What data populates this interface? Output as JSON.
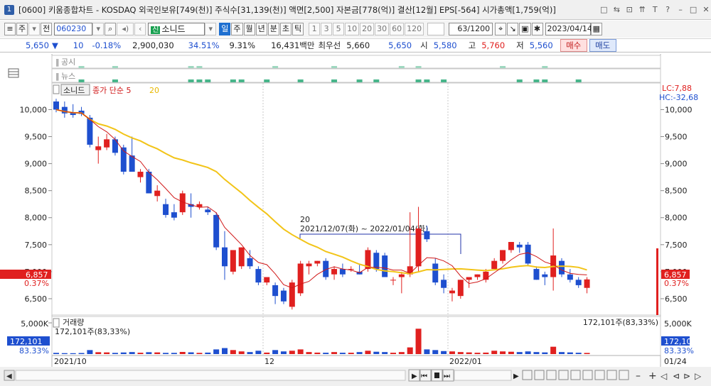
{
  "titlebar": {
    "window_number": "1",
    "title": "[0600] 키움종합차트 - KOSDAQ 외국인보유[749(천)] 주식수[31,139(천)] 액면[2,500] 자본금[778(억)] 결산[12월] EPS[-564] 시가총액[1,759(억)]",
    "buttons": [
      "□",
      "⇆",
      "⊡",
      "⇈",
      "T",
      "?",
      "–",
      "□",
      "✕"
    ]
  },
  "toolbar": {
    "period_label": "주",
    "all_label": "전",
    "code": "060230",
    "sin_label": "신",
    "stock_name": "소니드",
    "intervals": [
      "일",
      "주",
      "월",
      "년",
      "분",
      "초",
      "틱"
    ],
    "minute_values": [
      "1",
      "3",
      "5",
      "10",
      "20",
      "30",
      "60",
      "120"
    ],
    "count": "63",
    "count_total": "/1200",
    "date": "2023/04/14"
  },
  "price": {
    "current": "5,650",
    "arrow": "▼",
    "change": "10",
    "change_pct": "-0.18%",
    "volume": "2,900,030",
    "turnover": "34.51%",
    "vol_ratio": "9.31%",
    "amount": "16,431백만",
    "pref_label": "최우선",
    "best_ask": "5,660",
    "best_bid": "5,650",
    "open_label": "시",
    "open": "5,580",
    "high_label": "고",
    "high": "5,760",
    "low_label": "저",
    "low": "5,560",
    "buy_label": "매수",
    "sell_label": "매도"
  },
  "panels": {
    "disclosure_label": "공시",
    "news_label": "뉴스",
    "price_legend_name": "소니드",
    "price_legend_ma": "종가 단순 5",
    "price_legend_ma20": "20",
    "volume_label": "거래량",
    "volume_value": "172,101주(83,33%)",
    "volume_value_right": "172,101주(83,33%)",
    "range_title": "20",
    "range_text": "2021/12/07(화) ~ 2022/01/04(화)",
    "lc": "LC:7,88",
    "hc": "HC:-32,68",
    "last_price_tag": "6,857",
    "last_pct_tag": "0.37%",
    "vol_tag": "172,101",
    "vol_pct_tag": "83.33%",
    "vol_axis_top": "5,000K",
    "end_date": "01/24"
  },
  "colors": {
    "up": "#e0201f",
    "down": "#1e4fcf",
    "ma5": "#d01818",
    "ma20": "#f2c418"
  },
  "chart_data": {
    "type": "candlestick",
    "y_axis_ticks": [
      10000,
      9500,
      9000,
      8500,
      8000,
      7500,
      7000,
      6500
    ],
    "y_axis_labels": [
      "10,000",
      "9,500",
      "9,000",
      "8,500",
      "8,000",
      "7,500",
      "7,000",
      "6,500"
    ],
    "ylim": [
      6250,
      10400
    ],
    "x_axis_labels": [
      "2021/10",
      "12",
      "2022/01"
    ],
    "candles": [
      {
        "o": 10150,
        "h": 10200,
        "l": 9950,
        "c": 10000
      },
      {
        "o": 10050,
        "h": 10150,
        "l": 9850,
        "c": 9930
      },
      {
        "o": 9950,
        "h": 10100,
        "l": 9850,
        "c": 9900
      },
      {
        "o": 9980,
        "h": 10050,
        "l": 9880,
        "c": 9920
      },
      {
        "o": 9850,
        "h": 9900,
        "l": 9300,
        "c": 9350
      },
      {
        "o": 9250,
        "h": 9500,
        "l": 9000,
        "c": 9320
      },
      {
        "o": 9300,
        "h": 9550,
        "l": 9250,
        "c": 9450
      },
      {
        "o": 9450,
        "h": 9500,
        "l": 9150,
        "c": 9200
      },
      {
        "o": 9300,
        "h": 9350,
        "l": 8800,
        "c": 8850
      },
      {
        "o": 9150,
        "h": 9500,
        "l": 8850,
        "c": 8850
      },
      {
        "o": 8750,
        "h": 8900,
        "l": 8650,
        "c": 8850
      },
      {
        "o": 8850,
        "h": 8900,
        "l": 8450,
        "c": 8450
      },
      {
        "o": 8400,
        "h": 8600,
        "l": 8300,
        "c": 8500
      },
      {
        "o": 8250,
        "h": 8350,
        "l": 8000,
        "c": 8050
      },
      {
        "o": 8100,
        "h": 8250,
        "l": 7950,
        "c": 8000
      },
      {
        "o": 8100,
        "h": 8500,
        "l": 8050,
        "c": 8450
      },
      {
        "o": 8250,
        "h": 8450,
        "l": 8000,
        "c": 8200
      },
      {
        "o": 8200,
        "h": 8300,
        "l": 8150,
        "c": 8250
      },
      {
        "o": 8150,
        "h": 8200,
        "l": 8050,
        "c": 8100
      },
      {
        "o": 8050,
        "h": 8100,
        "l": 7400,
        "c": 7450
      },
      {
        "o": 7450,
        "h": 7750,
        "l": 6850,
        "c": 7100
      },
      {
        "o": 7000,
        "h": 7200,
        "l": 6950,
        "c": 7400
      },
      {
        "o": 7100,
        "h": 7450,
        "l": 7050,
        "c": 7450
      },
      {
        "o": 7250,
        "h": 7400,
        "l": 7050,
        "c": 7100
      },
      {
        "o": 7050,
        "h": 7100,
        "l": 6750,
        "c": 6800
      },
      {
        "o": 6800,
        "h": 6850,
        "l": 6750,
        "c": 6900
      },
      {
        "o": 6750,
        "h": 6800,
        "l": 6400,
        "c": 6550
      },
      {
        "o": 6650,
        "h": 6700,
        "l": 6400,
        "c": 6450
      },
      {
        "o": 6350,
        "h": 6850,
        "l": 6300,
        "c": 6800
      },
      {
        "o": 6600,
        "h": 7200,
        "l": 6550,
        "c": 7150
      },
      {
        "o": 7100,
        "h": 7200,
        "l": 6950,
        "c": 7150
      },
      {
        "o": 7150,
        "h": 7200,
        "l": 7100,
        "c": 7200
      },
      {
        "o": 7200,
        "h": 7250,
        "l": 6850,
        "c": 6900
      },
      {
        "o": 6950,
        "h": 7100,
        "l": 6850,
        "c": 7050
      },
      {
        "o": 7050,
        "h": 7150,
        "l": 6900,
        "c": 6950
      },
      {
        "o": 7050,
        "h": 7100,
        "l": 7000,
        "c": 7050
      },
      {
        "o": 7000,
        "h": 7150,
        "l": 6950,
        "c": 6950
      },
      {
        "o": 7050,
        "h": 7450,
        "l": 7000,
        "c": 7400
      },
      {
        "o": 7350,
        "h": 7400,
        "l": 7000,
        "c": 7050
      },
      {
        "o": 7300,
        "h": 7350,
        "l": 6900,
        "c": 6900
      },
      {
        "o": 6850,
        "h": 6900,
        "l": 6750,
        "c": 6850
      },
      {
        "o": 6900,
        "h": 7000,
        "l": 6600,
        "c": 6950
      },
      {
        "o": 6950,
        "h": 8100,
        "l": 6900,
        "c": 7100
      },
      {
        "o": 7100,
        "h": 8200,
        "l": 7000,
        "c": 7800
      },
      {
        "o": 7750,
        "h": 7850,
        "l": 7550,
        "c": 7600
      },
      {
        "o": 7150,
        "h": 7250,
        "l": 6750,
        "c": 6800
      },
      {
        "o": 6850,
        "h": 6950,
        "l": 6600,
        "c": 6700
      },
      {
        "o": 6600,
        "h": 6700,
        "l": 6450,
        "c": 6650
      },
      {
        "o": 6550,
        "h": 6850,
        "l": 6500,
        "c": 6850
      },
      {
        "o": 6850,
        "h": 6900,
        "l": 6700,
        "c": 6900
      },
      {
        "o": 6900,
        "h": 6950,
        "l": 6850,
        "c": 6950
      },
      {
        "o": 6850,
        "h": 7050,
        "l": 6800,
        "c": 7000
      },
      {
        "o": 7050,
        "h": 7250,
        "l": 7050,
        "c": 7200
      },
      {
        "o": 7200,
        "h": 7400,
        "l": 7150,
        "c": 7400
      },
      {
        "o": 7400,
        "h": 7550,
        "l": 7350,
        "c": 7550
      },
      {
        "o": 7500,
        "h": 7550,
        "l": 7350,
        "c": 7450
      },
      {
        "o": 7500,
        "h": 7550,
        "l": 7100,
        "c": 7150
      },
      {
        "o": 7050,
        "h": 7100,
        "l": 6850,
        "c": 6850
      },
      {
        "o": 6950,
        "h": 7000,
        "l": 6750,
        "c": 6900
      },
      {
        "o": 6900,
        "h": 7800,
        "l": 6650,
        "c": 7300
      },
      {
        "o": 7200,
        "h": 7250,
        "l": 6900,
        "c": 6950
      },
      {
        "o": 6950,
        "h": 7050,
        "l": 6800,
        "c": 6850
      },
      {
        "o": 6850,
        "h": 6900,
        "l": 6700,
        "c": 6750
      },
      {
        "o": 6700,
        "h": 6900,
        "l": 6600,
        "c": 6857
      }
    ],
    "volume_ylim": [
      0,
      5000
    ],
    "volumes": [
      180,
      140,
      130,
      160,
      600,
      280,
      250,
      180,
      240,
      300,
      200,
      280,
      250,
      180,
      180,
      320,
      260,
      180,
      220,
      700,
      900,
      600,
      400,
      300,
      500,
      220,
      600,
      400,
      500,
      700,
      300,
      220,
      200,
      300,
      200,
      200,
      300,
      500,
      350,
      300,
      200,
      300,
      1000,
      3800,
      700,
      600,
      450,
      400,
      300,
      250,
      200,
      220,
      500,
      400,
      350,
      300,
      400,
      300,
      250,
      1100,
      300,
      250,
      200,
      172
    ]
  }
}
